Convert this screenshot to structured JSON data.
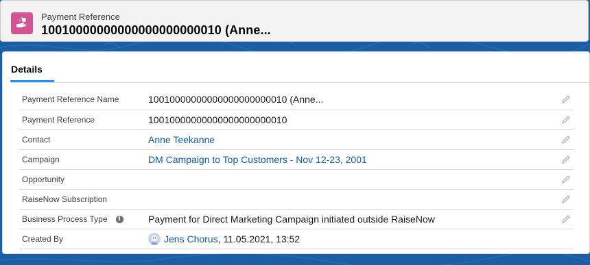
{
  "header": {
    "object_label": "Payment Reference",
    "record_title": "10010000000000000000000010 (Anne...",
    "icon": "hand-coin-icon",
    "icon_color": "#d45392"
  },
  "tabs": {
    "active": "Details"
  },
  "fields": [
    {
      "label": "Payment Reference Name",
      "value": "10010000000000000000000010 (Anne..."
    },
    {
      "label": "Payment Reference",
      "value": "10010000000000000000000010"
    },
    {
      "label": "Contact",
      "value": "Anne Teekanne"
    },
    {
      "label": "Campaign",
      "value": "DM Campaign to Top Customers - Nov 12-23, 2001"
    },
    {
      "label": "Opportunity",
      "value": ""
    },
    {
      "label": "RaiseNow Subscription",
      "value": ""
    },
    {
      "label": "Business Process Type",
      "value": "Payment for Direct Marketing Campaign initiated outside RaiseNow"
    },
    {
      "label": "Created By",
      "user": "Jens Chorus",
      "date": ", 11.05.2021, 13:52"
    }
  ],
  "colors": {
    "link": "#0b5cab",
    "tab_accent": "#1b96ff",
    "background": "#1b5ea5"
  }
}
